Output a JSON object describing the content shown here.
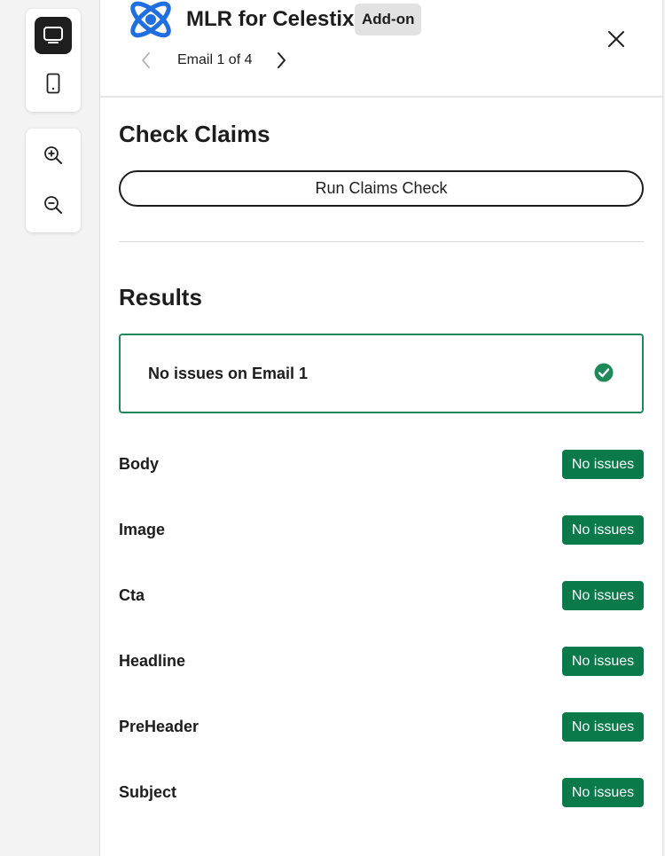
{
  "toolbar": {
    "view": {
      "desktop_icon": "monitor-icon",
      "mobile_icon": "phone-icon",
      "active": "desktop"
    },
    "zoom": {
      "zoom_in_icon": "zoom-in-icon",
      "zoom_out_icon": "zoom-out-icon"
    }
  },
  "header": {
    "logo_icon": "atom-logo-icon",
    "title": "MLR for Celestix",
    "badge": "Add-on",
    "close_icon": "close-icon",
    "pager": {
      "prev_icon": "chevron-left-icon",
      "label": "Email 1 of 4",
      "next_icon": "chevron-right-icon"
    }
  },
  "check": {
    "title": "Check Claims",
    "run_button": "Run Claims Check"
  },
  "results": {
    "title": "Results",
    "summary": {
      "text": "No issues on Email 1",
      "icon": "check-circle-icon"
    },
    "rows": [
      {
        "label": "Body",
        "status": "No issues"
      },
      {
        "label": "Image",
        "status": "No issues"
      },
      {
        "label": "Cta",
        "status": "No issues"
      },
      {
        "label": "Headline",
        "status": "No issues"
      },
      {
        "label": "PreHeader",
        "status": "No issues"
      },
      {
        "label": "Subject",
        "status": "No issues"
      }
    ]
  },
  "colors": {
    "success": "#0b7a4b",
    "success_border": "#1e8a5a",
    "logo_blue": "#1f6fe0",
    "active_tool": "#1e1e1e"
  }
}
